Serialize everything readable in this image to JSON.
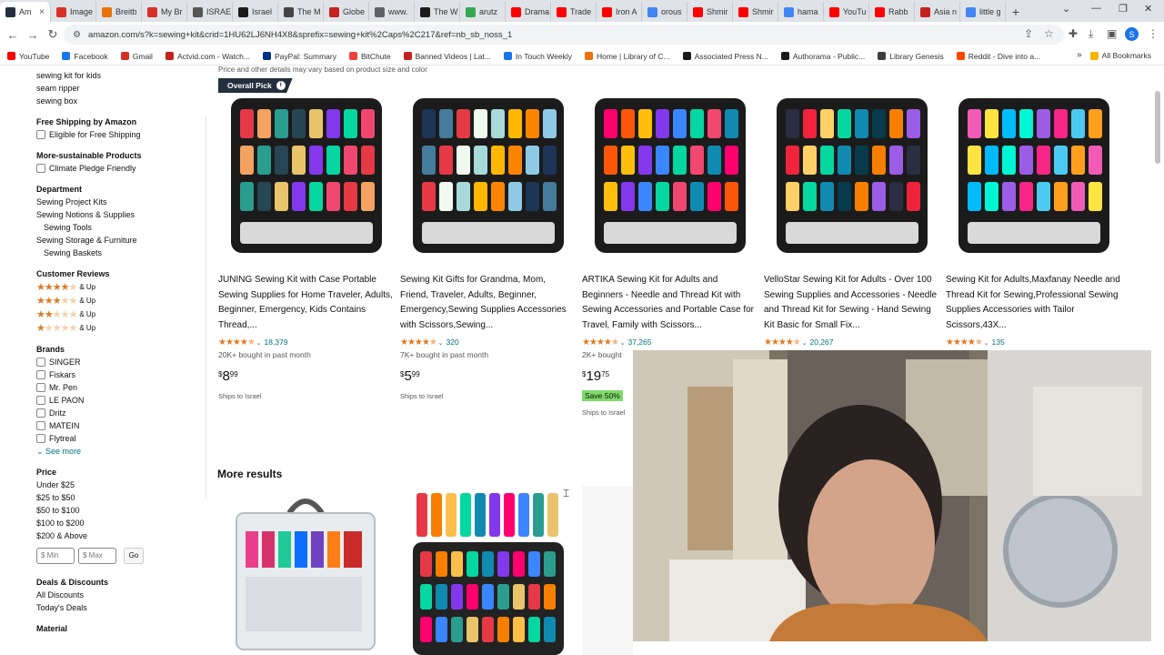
{
  "browser": {
    "tabs": [
      {
        "label": "Am",
        "color": "#232f3e"
      },
      {
        "label": "Image",
        "color": "#d93025"
      },
      {
        "label": "Breitb",
        "color": "#e8710a"
      },
      {
        "label": "My Br",
        "color": "#d93025"
      },
      {
        "label": "ISRAE",
        "color": "#555555"
      },
      {
        "label": "Israel",
        "color": "#1a1a1a"
      },
      {
        "label": "The M",
        "color": "#444444"
      },
      {
        "label": "Globe",
        "color": "#c5221f"
      },
      {
        "label": "www.",
        "color": "#5f6368"
      },
      {
        "label": "The W",
        "color": "#1a1a1a"
      },
      {
        "label": "arutz",
        "color": "#34a853"
      },
      {
        "label": "Drama",
        "color": "#ff0000"
      },
      {
        "label": "Trade",
        "color": "#ff0000"
      },
      {
        "label": "Iron A",
        "color": "#ff0000"
      },
      {
        "label": "orous",
        "color": "#4285f4"
      },
      {
        "label": "Shmir",
        "color": "#ff0000"
      },
      {
        "label": "Shmir",
        "color": "#ff0000"
      },
      {
        "label": "hama",
        "color": "#4285f4"
      },
      {
        "label": "YouTu",
        "color": "#ff0000"
      },
      {
        "label": "Rabb",
        "color": "#ff0000"
      },
      {
        "label": "Asia n",
        "color": "#c5221f"
      },
      {
        "label": "little g",
        "color": "#4285f4"
      }
    ],
    "tab_close": "×",
    "new_tab": "+",
    "url": "amazon.com/s?k=sewing+kit&crid=1HU62LJ6NH4X8&sprefix=sewing+kit%2Caps%2C217&ref=nb_sb_noss_1",
    "avatar_letter": "S",
    "bookmarks": [
      {
        "label": "YouTube",
        "color": "#ff0000"
      },
      {
        "label": "Facebook",
        "color": "#1877f2"
      },
      {
        "label": "Gmail",
        "color": "#d93025"
      },
      {
        "label": "Actvid.com - Watch...",
        "color": "#c5221f"
      },
      {
        "label": "PayPal: Summary",
        "color": "#003087"
      },
      {
        "label": "BitChute",
        "color": "#ef4137"
      },
      {
        "label": "Banned Videos | Lat...",
        "color": "#c5221f"
      },
      {
        "label": "In Touch Weekly",
        "color": "#1a73e8"
      },
      {
        "label": "Home | Library of C...",
        "color": "#e8710a"
      },
      {
        "label": "Associated Press N...",
        "color": "#1a1a1a"
      },
      {
        "label": "Authorama - Public...",
        "color": "#1a1a1a"
      },
      {
        "label": "Library Genesis",
        "color": "#3c4043"
      },
      {
        "label": "Reddit - Dive into a...",
        "color": "#ff4500"
      }
    ],
    "all_bookmarks": "All Bookmarks"
  },
  "sidebar": {
    "top_links": [
      "sewing kit for kids",
      "seam ripper",
      "sewing box"
    ],
    "free_shipping": {
      "heading": "Free Shipping by Amazon",
      "option": "Eligible for Free Shipping"
    },
    "sustainable": {
      "heading": "More-sustainable Products",
      "option": "Climate Pledge Friendly"
    },
    "department": {
      "heading": "Department",
      "items": [
        "Sewing Project Kits",
        "Sewing Notions & Supplies",
        "Sewing Tools",
        "Sewing Storage & Furniture",
        "Sewing Baskets"
      ]
    },
    "reviews": {
      "heading": "Customer Reviews",
      "up_label": "& Up",
      "levels": [
        4,
        3,
        2,
        1
      ]
    },
    "brands": {
      "heading": "Brands",
      "items": [
        "SINGER",
        "Fiskars",
        "Mr. Pen",
        "LE PAON",
        "Dritz",
        "MATEIN",
        "Flytreal"
      ],
      "see_more": "See more"
    },
    "price": {
      "heading": "Price",
      "ranges": [
        "Under $25",
        "$25 to $50",
        "$50 to $100",
        "$100 to $200",
        "$200 & Above"
      ],
      "min_placeholder": "$ Min",
      "max_placeholder": "$ Max",
      "go": "Go"
    },
    "deals": {
      "heading": "Deals & Discounts",
      "items": [
        "All Discounts",
        "Today's Deals"
      ]
    },
    "material_heading": "Material"
  },
  "results": {
    "disclaimer": "Price and other details may vary based on product size and color",
    "overall_pick": "Overall Pick",
    "products": [
      {
        "title": "JUNING Sewing Kit with Case Portable Sewing Supplies for Home Traveler, Adults, Beginner, Emergency, Kids Contains Thread,...",
        "rating": 4.5,
        "reviews": "18,379",
        "bought": "20K+ bought in past month",
        "price_currency": "$",
        "price_whole": "8",
        "price_fraction": "99",
        "save": "",
        "ships": "Ships to Israel"
      },
      {
        "title": "Sewing Kit Gifts for Grandma, Mom, Friend, Traveler, Adults, Beginner, Emergency,Sewing Supplies Accessories with Scissors,Sewing...",
        "rating": 4.5,
        "reviews": "320",
        "bought": "7K+ bought in past month",
        "price_currency": "$",
        "price_whole": "5",
        "price_fraction": "99",
        "save": "",
        "ships": "Ships to Israel"
      },
      {
        "title": "ARTIKA Sewing Kit for Adults and Beginners - Needle and Thread Kit with Sewing Accessories and Portable Case for Travel, Family with Scissors...",
        "rating": 4.5,
        "reviews": "37,265",
        "bought": "2K+ bought",
        "price_currency": "$",
        "price_whole": "19",
        "price_fraction": "75",
        "save": "Save 50%",
        "ships": "Ships to Israel"
      },
      {
        "title": "VelloStar Sewing Kit for Adults - Over 100 Sewing Supplies and Accessories - Needle and Thread Kit for Sewing - Hand Sewing Kit Basic for Small Fix...",
        "rating": 4.5,
        "reviews": "20,267",
        "bought": "",
        "price_currency": "",
        "price_whole": "",
        "price_fraction": "",
        "save": "",
        "ships": ""
      },
      {
        "title": "Sewing Kit for Adults,Maxfanay Needle and Thread Kit for Sewing,Professional Sewing Supplies Accessories with Tailor Scissors,43X...",
        "rating": 4.5,
        "reviews": "135",
        "bought": "",
        "price_currency": "",
        "price_whole": "",
        "price_fraction": "",
        "save": "",
        "ships": ""
      }
    ],
    "more_results": "More results"
  },
  "colors": {
    "link": "#007185",
    "star": "#de7921",
    "badge_dark": "#232f3e",
    "save_green": "#7fda69"
  }
}
